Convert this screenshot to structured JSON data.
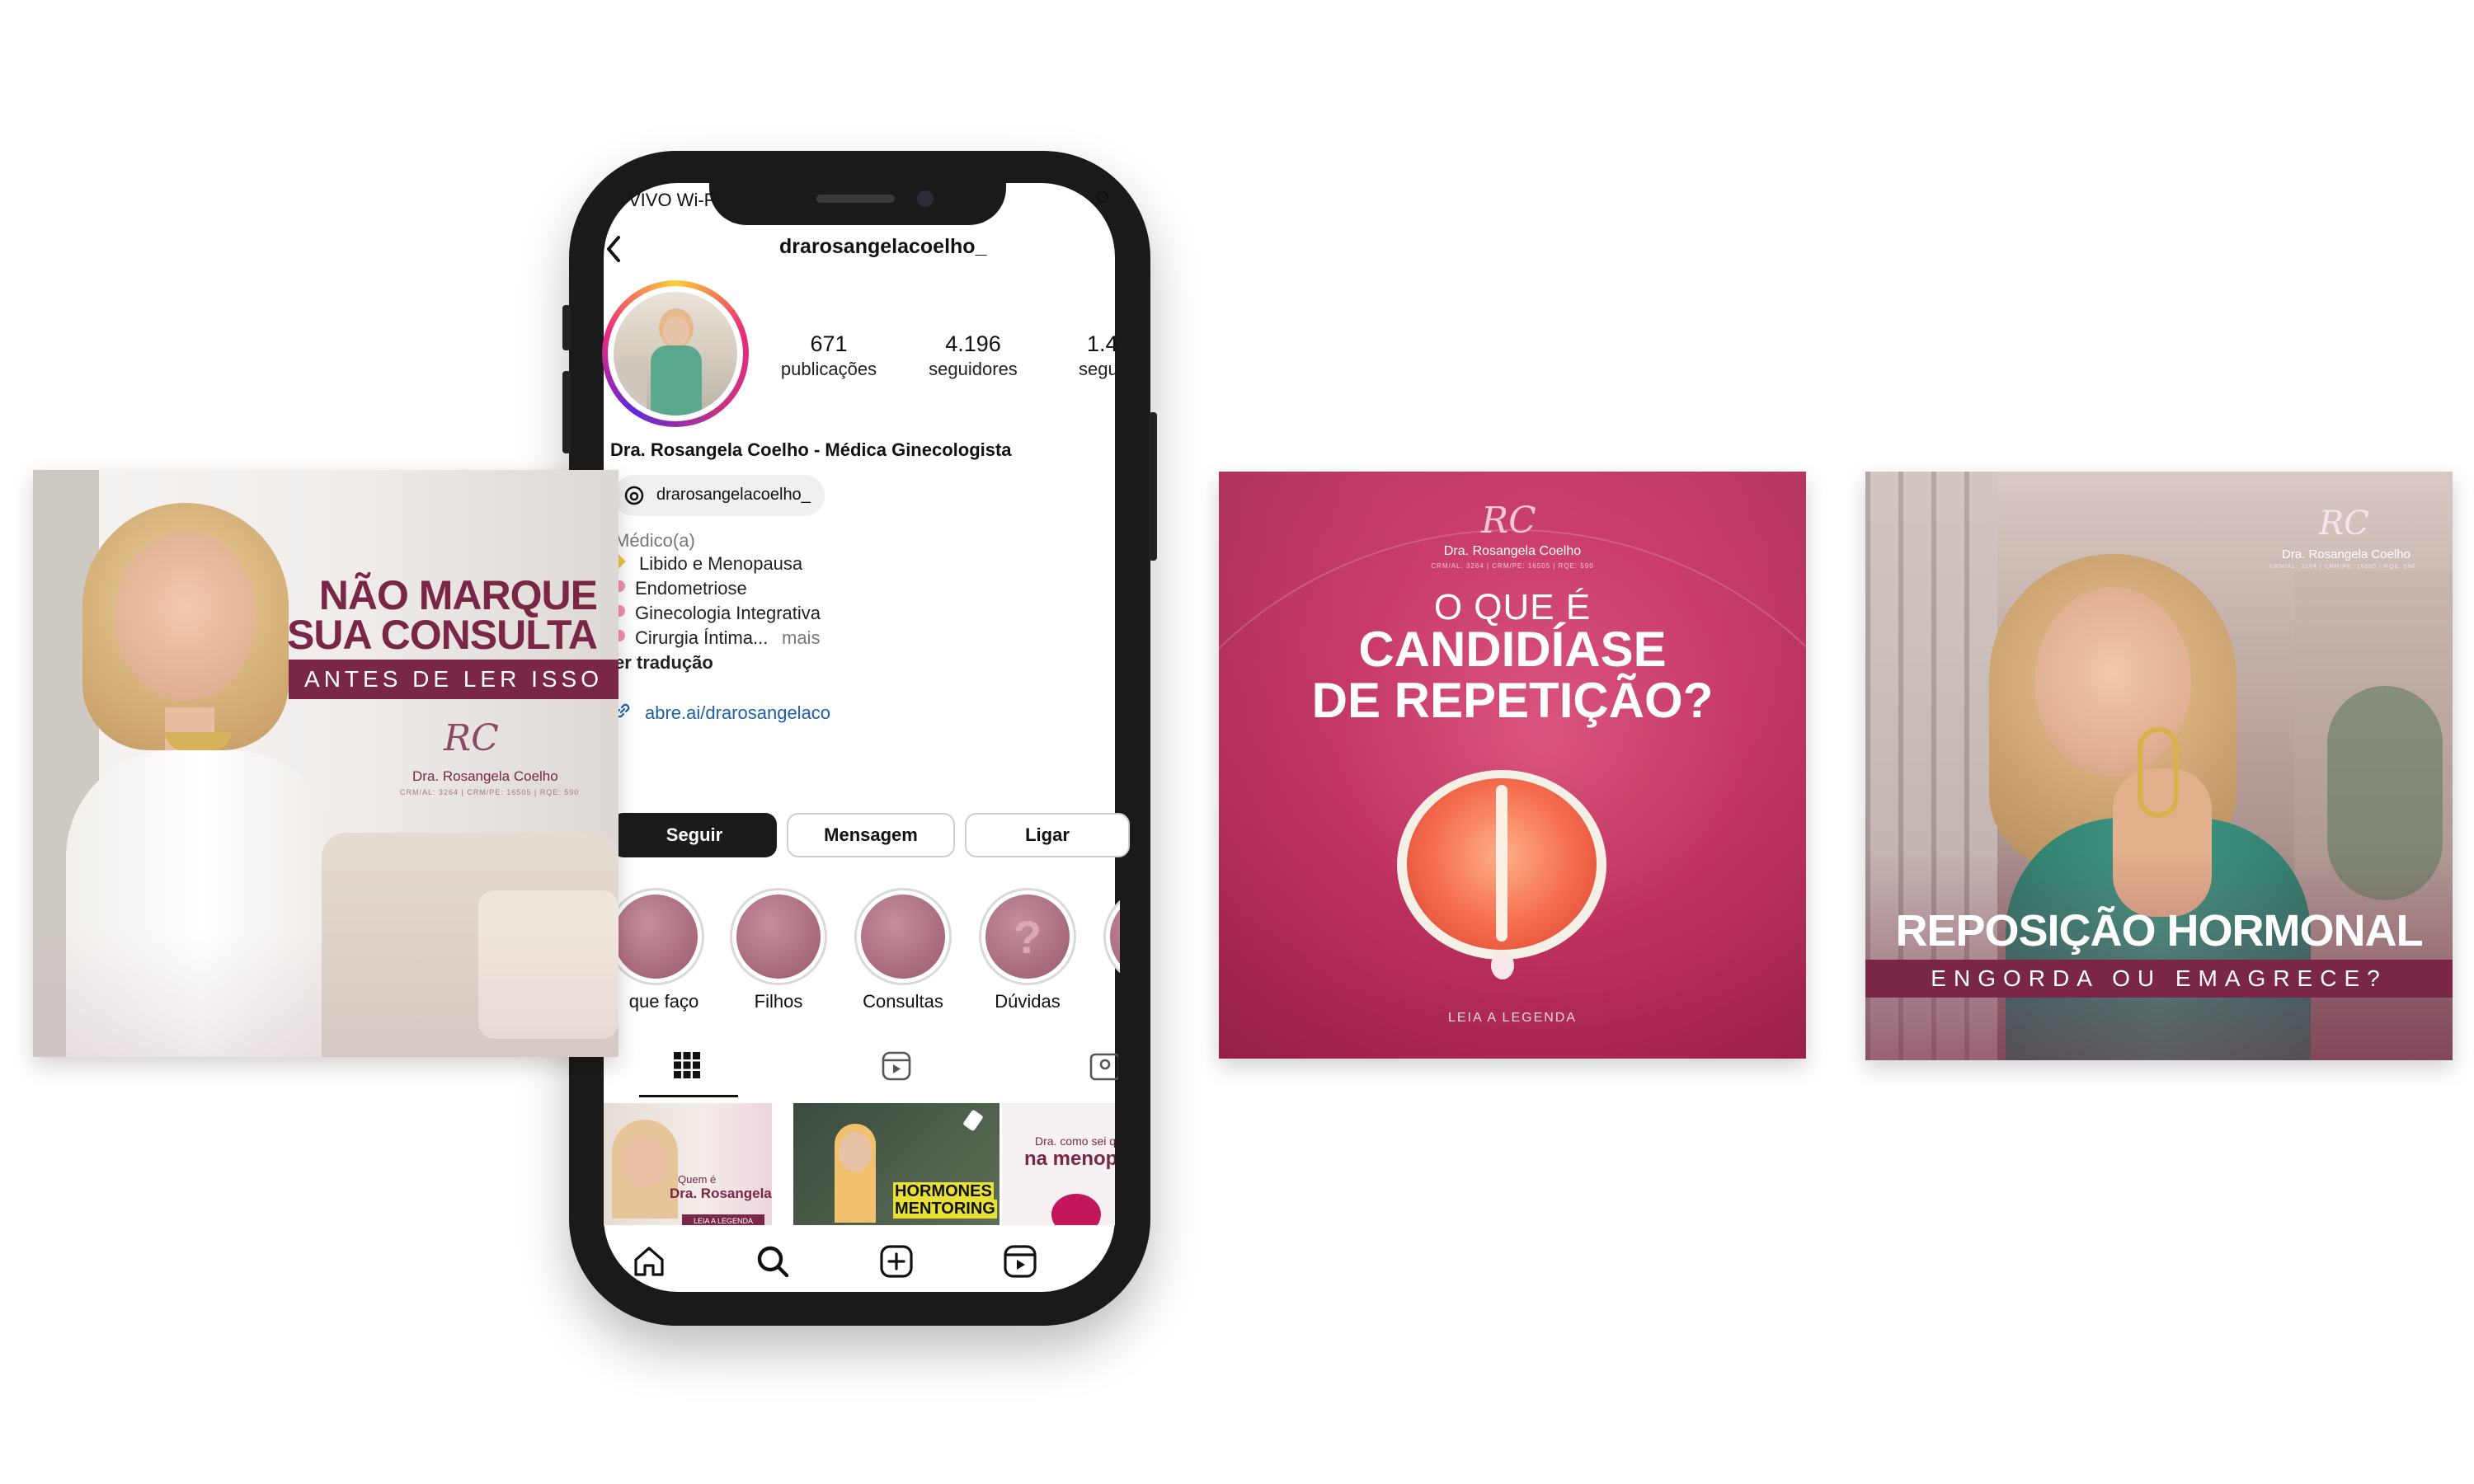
{
  "post_left": {
    "headline_1": "NÃO MARQUE",
    "headline_2": "SUA CONSULTA",
    "ribbon": "ANTES DE LER ISSO",
    "logo_initials": "RC",
    "logo_name": "Dra. Rosangela Coelho",
    "logo_credentials": "CRM/AL: 3264 | CRM/PE: 16505 | RQE: 590"
  },
  "phone": {
    "status_carrier": "VIVO Wi-F",
    "username": "drarosangelacoelho_",
    "stats": [
      {
        "num": "671",
        "label": "publicações"
      },
      {
        "num": "4.196",
        "label": "seguidores"
      },
      {
        "num": "1.4",
        "label": "segu"
      }
    ],
    "display_name": "Dra. Rosangela Coelho - Médica Ginecologista",
    "threads_handle": "drarosangelacoelho_",
    "category": "Médico(a)",
    "bio_lines": [
      "Libido e Menopausa",
      "Endometriose",
      "Ginecologia Integrativa",
      "Cirurgia Íntima..."
    ],
    "bio_more": "mais",
    "translate": "er tradução",
    "link": "abre.ai/drarosangelaco",
    "buttons": {
      "follow": "Seguir",
      "message": "Mensagem",
      "call": "Ligar"
    },
    "highlights": [
      {
        "label": "que faço"
      },
      {
        "label": "Filhos"
      },
      {
        "label": "Consultas"
      },
      {
        "label": "Dúvidas"
      }
    ],
    "grid_posts": {
      "post1_small": "Quem é",
      "post1_big": "Dra. Rosangela?",
      "post1_footer": "LEIA A LEGENDA",
      "post2_line1": "HORMONES",
      "post2_line2": "MENTORING",
      "post3_small": "Dra. como sei q",
      "post3_big": "na menop"
    }
  },
  "post_middle": {
    "logo_initials": "RC",
    "logo_name": "Dra. Rosangela Coelho",
    "logo_credentials": "CRM/AL: 3264 | CRM/PE: 16505 | RQE: 590",
    "line_1": "O QUE É",
    "line_2": "CANDIDÍASE",
    "line_3": "DE REPETIÇÃO?",
    "footer": "LEIA A LEGENDA"
  },
  "post_right": {
    "logo_initials": "RC",
    "logo_name": "Dra. Rosangela Coelho",
    "logo_credentials": "CRM/AL: 3264 | CRM/PE: 16505 | RQE: 590",
    "headline": "REPOSIÇÃO HORMONAL",
    "ribbon": "ENGORDA OU EMAGRECE?"
  },
  "colors": {
    "wine": "#7a2747",
    "pink_card": "#c7305f",
    "pink_dark": "#8e1c44",
    "ig_link": "#1d5fa8"
  }
}
